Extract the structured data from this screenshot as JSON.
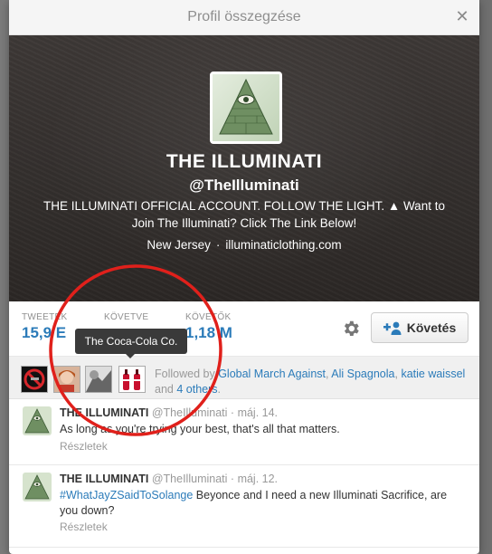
{
  "modal": {
    "title": "Profil összegzése",
    "close_icon": "close-icon"
  },
  "profile": {
    "name": "THE ILLUMINATI",
    "handle": "@TheIlluminati",
    "bio": "THE ILLUMINATI OFFICIAL ACCOUNT. FOLLOW THE LIGHT. ▲ Want to Join The Illuminati? Click The Link Below!",
    "location": "New Jersey",
    "separator": "·",
    "website": "illuminaticlothing.com"
  },
  "stats": {
    "tweets_label": "TWEETEK",
    "tweets_value": "15,9 E",
    "following_label": "KÖVETVE",
    "following_value": "",
    "followers_label": "KÖVETŐK",
    "followers_value": "1,18 M"
  },
  "actions": {
    "follow_label": "Követés",
    "gear_icon": "gear-icon",
    "follow_icon": "user-plus-icon"
  },
  "tooltip": {
    "text": "The Coca-Cola Co."
  },
  "followed_by": {
    "prefix": "Followed by",
    "names": [
      "Global March Against",
      "Ali Spagnola",
      "katie waissel"
    ],
    "sep1": ",",
    "sep2": ",",
    "and_text": "and",
    "others": "4 others",
    "period": "."
  },
  "tweets": [
    {
      "name": "THE ILLUMINATI",
      "handle": "@TheIlluminati",
      "sep": "·",
      "date": "máj. 14.",
      "text": "As long as you're trying your best, that's all that matters.",
      "hashtag": "",
      "more": "Részletek"
    },
    {
      "name": "THE ILLUMINATI",
      "handle": "@TheIlluminati",
      "sep": "·",
      "date": "máj. 12.",
      "hashtag": "#WhatJayZSaidToSolange",
      "text": " Beyonce and I need a new Illuminati Sacrifice, are you down?",
      "more": "Részletek"
    }
  ],
  "colors": {
    "link": "#2b7bb9",
    "annotation": "#e0201b"
  }
}
